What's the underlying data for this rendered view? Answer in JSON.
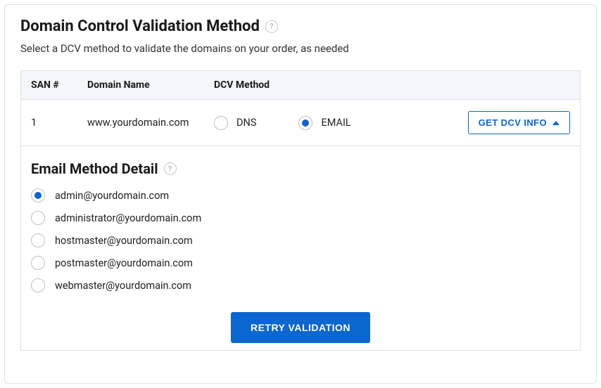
{
  "heading": "Domain Control Validation Method",
  "subtext": "Select a DCV method to validate the domains on your order, as needed",
  "columns": {
    "san": "SAN #",
    "domain": "Domain Name",
    "method": "DCV Method"
  },
  "row": {
    "san": "1",
    "domain": "www.yourdomain.com",
    "options": {
      "dns": "DNS",
      "email": "EMAIL"
    },
    "selected": "email",
    "get_info_label": "GET DCV INFO"
  },
  "detail": {
    "heading": "Email Method Detail",
    "emails": [
      "admin@yourdomain.com",
      "administrator@yourdomain.com",
      "hostmaster@yourdomain.com",
      "postmaster@yourdomain.com",
      "webmaster@yourdomain.com"
    ],
    "selected_index": 0
  },
  "retry_label": "RETRY VALIDATION"
}
